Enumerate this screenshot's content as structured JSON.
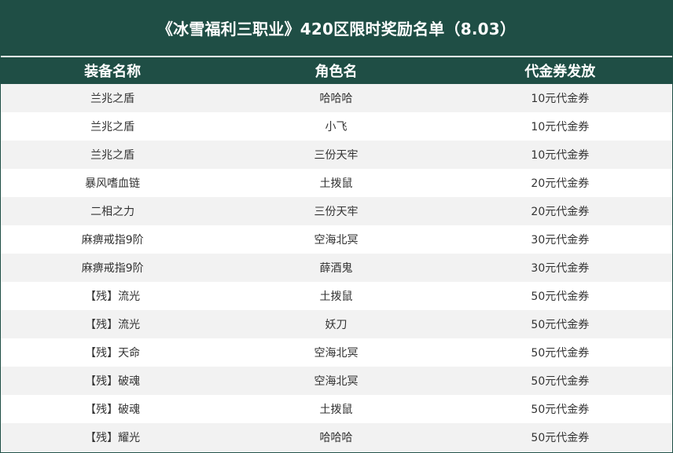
{
  "title": "《冰雪福利三职业》420区限时奖励名单（8.03）",
  "headers": {
    "equipment": "装备名称",
    "character": "角色名",
    "voucher": "代金券发放"
  },
  "rows": [
    {
      "equipment": "兰兆之盾",
      "character": "哈哈哈",
      "voucher": "10元代金券"
    },
    {
      "equipment": "兰兆之盾",
      "character": "小飞",
      "voucher": "10元代金券"
    },
    {
      "equipment": "兰兆之盾",
      "character": "三份天牢",
      "voucher": "10元代金券"
    },
    {
      "equipment": "暴风嗜血链",
      "character": "土拨鼠",
      "voucher": "20元代金券"
    },
    {
      "equipment": "二相之力",
      "character": "三份天牢",
      "voucher": "20元代金券"
    },
    {
      "equipment": "麻痹戒指9阶",
      "character": "空海北冥",
      "voucher": "30元代金券"
    },
    {
      "equipment": "麻痹戒指9阶",
      "character": "薛酒鬼",
      "voucher": "30元代金券"
    },
    {
      "equipment": "【残】流光",
      "character": "土拨鼠",
      "voucher": "50元代金券"
    },
    {
      "equipment": "【残】流光",
      "character": "妖刀",
      "voucher": "50元代金券"
    },
    {
      "equipment": "【残】天命",
      "character": "空海北冥",
      "voucher": "50元代金券"
    },
    {
      "equipment": "【残】破魂",
      "character": "空海北冥",
      "voucher": "50元代金券"
    },
    {
      "equipment": "【残】破魂",
      "character": "土拨鼠",
      "voucher": "50元代金券"
    },
    {
      "equipment": "【残】耀光",
      "character": "哈哈哈",
      "voucher": "50元代金券"
    }
  ]
}
